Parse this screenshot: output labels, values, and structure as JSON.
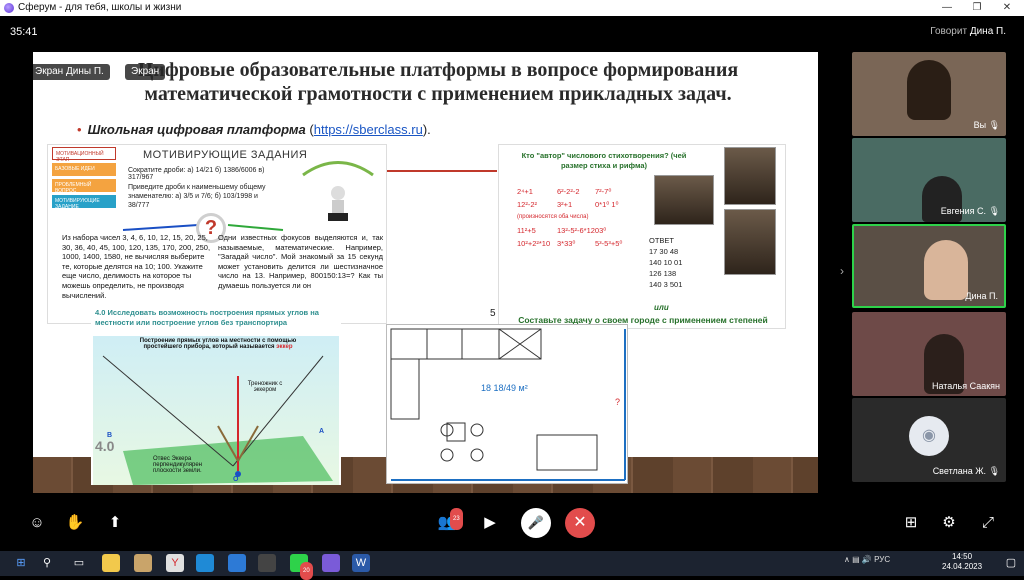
{
  "window": {
    "title": "Сферум - для тебя, школы и жизни",
    "minimize": "—",
    "maximize": "❐",
    "close": "✕"
  },
  "meeting": {
    "timer": "35:41",
    "speaking_label": "Говорит",
    "speaking_name": "Дина П."
  },
  "screen_share": {
    "tag_owner": "Экран Дины П.",
    "tag_screen": "Экран"
  },
  "slide": {
    "title": "Цифровые образовательные платформы в вопросе формирования математической грамотности с применением прикладных задач.",
    "bullet_label": "Школьная цифровая платформа",
    "bullet_paren_open": "(",
    "bullet_link": "https://sberclass.ru",
    "bullet_paren_close": ").",
    "left_panel": {
      "tabs": [
        "МОТИВАЦИОННЫЙ ЭТАП",
        "БАЗОВЫЕ ИДЕИ",
        "ПРОБЛЕМНЫЙ ВОПРОС",
        "МОТИВИРУЮЩИЕ ЗАДАНИЕ"
      ],
      "title": "МОТИВИРУЮЩИЕ ЗАДАНИЯ",
      "task1": "Сократите дроби:  а) 14/21   б) 1386/6006   в) 317/967",
      "task2": "Приведите дроби к наименьшему общему знаменателю:  а) 3/5 и 7/6;   б) 103/1998 и 38/777",
      "left_text": "Из набора чисел 3, 4, 6, 10, 12, 15, 20, 25, 30, 36, 40, 45, 100, 120, 135, 170, 200, 250, 1000, 1400, 1580, не вычисляя выберите те, которые делятся на 10; 100. Укажите еще число, делимость на которое ты можешь определить, не производя вычислений.",
      "right_text": "Одни известных фокусов выделяются и, так называемые, математические. Например, \"Загадай число\". Мой знакомый за 15 секунд может установить делится ли шестизначное число на 13. Например, 800150:13=? Как ты думаешь пользуется ли он",
      "qmark": "?"
    },
    "right_panel": {
      "question": "Кто \"автор\" числового стихотворения? (чей размер стиха и рифма)",
      "col1": [
        "2⁴+1",
        "12²-2²",
        "(произносятся оба числа)",
        "11²+5",
        "10²+2²*10"
      ],
      "col2": [
        "6²-2²-2",
        "3²+1",
        "",
        "13²-5²-6*1203⁰",
        "3*33⁰"
      ],
      "col3": [
        "7²-7⁰",
        "0*1⁰ 1⁰",
        "",
        "",
        "5³-5³+5⁰"
      ],
      "answer_label": "ОТВЕТ",
      "answer_rows": [
        "17    30   48",
        "140   10   01",
        "126     138",
        "140    3    501"
      ],
      "or": "или",
      "task": "Составьте задачу о своем городе с применением степеней",
      "num": "5"
    },
    "bottom_left": {
      "title": "4.0 Исследовать возможность построения прямых углов на местности или построение углов без транспортира",
      "caption": "Построение прямых углов на местности с помощью простейшего прибора, который называется",
      "caption_word": "эккер",
      "tripod": "Треножник с эккером",
      "plumb": "Отвес Эккера перпендикулярен плоскости земли.",
      "point_b": "В",
      "point_a": "А",
      "point_o": "О",
      "tag": "4.0"
    },
    "bottom_mid": {
      "area": "18 18/49 м²",
      "question_mark": "?"
    }
  },
  "participants": [
    {
      "name": "Вы",
      "muted": true
    },
    {
      "name": "Евгения С.",
      "muted": true
    },
    {
      "name": "Дина П.",
      "muted": false,
      "active": true
    },
    {
      "name": "Наталья Саакян",
      "muted": true
    },
    {
      "name": "Светлана Ж.",
      "muted": true
    }
  ],
  "toolbar": {
    "participants_count": "23"
  },
  "taskbar": {
    "lang": "РУС",
    "time": "14:50",
    "date": "24.04.2023",
    "whatsapp_badge": "20"
  },
  "colors": {
    "accent_green": "#2ed24a",
    "end_call": "#e24c4c",
    "slide_green": "#27712b",
    "slide_red": "#d4262c"
  }
}
